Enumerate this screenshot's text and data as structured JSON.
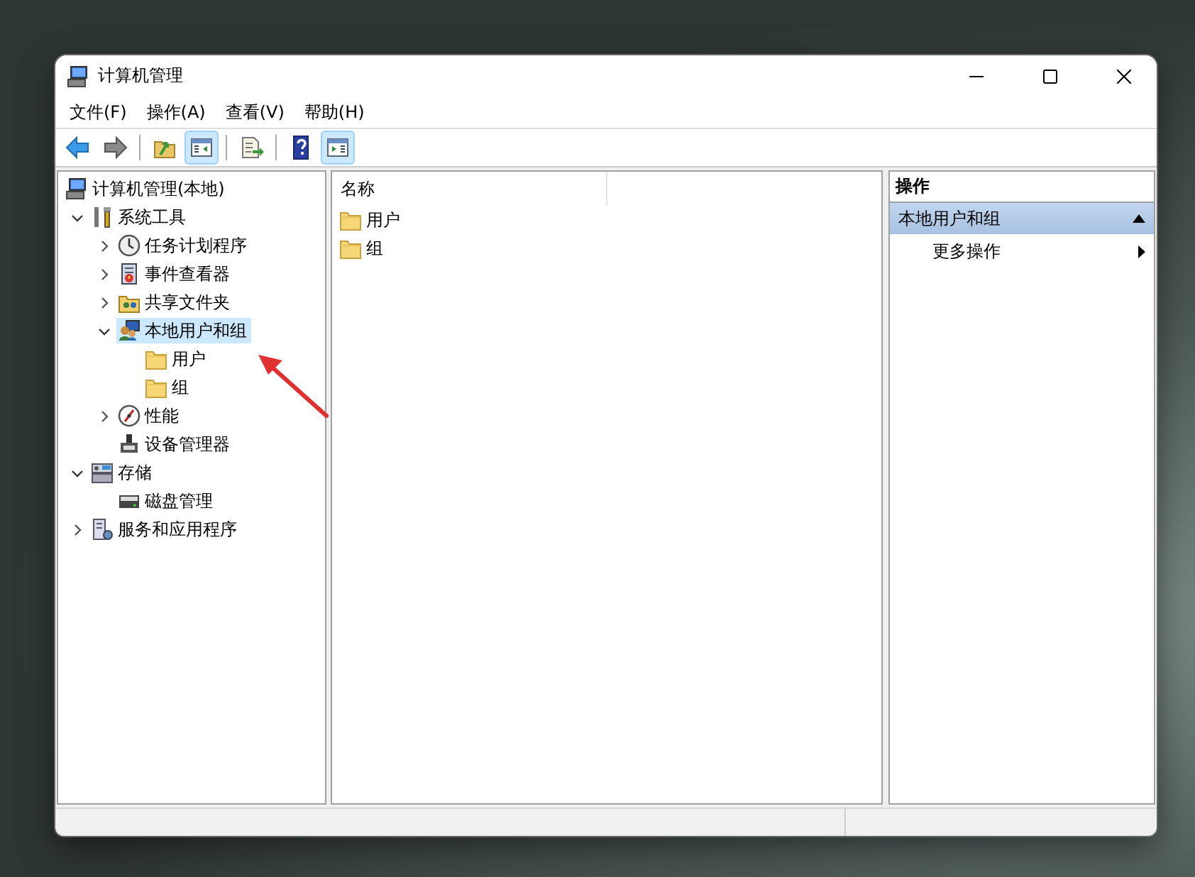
{
  "window": {
    "title": "计算机管理"
  },
  "menu": [
    {
      "label": "文件(F)"
    },
    {
      "label": "操作(A)"
    },
    {
      "label": "查看(V)"
    },
    {
      "label": "帮助(H)"
    }
  ],
  "toolbar": [
    {
      "kind": "back",
      "pressed": false
    },
    {
      "kind": "forward",
      "pressed": false
    },
    {
      "kind": "separator"
    },
    {
      "kind": "up",
      "pressed": false
    },
    {
      "kind": "tree-toggle",
      "pressed": true
    },
    {
      "kind": "separator"
    },
    {
      "kind": "export",
      "pressed": false
    },
    {
      "kind": "separator"
    },
    {
      "kind": "help",
      "pressed": false
    },
    {
      "kind": "action-toggle",
      "pressed": true
    }
  ],
  "tree": [
    {
      "label": "计算机管理(本地)",
      "kind": "computer",
      "selected": false,
      "children": [
        {
          "label": "系统工具",
          "kind": "tools",
          "expanded": true,
          "selected": false,
          "children": [
            {
              "label": "任务计划程序",
              "kind": "clock",
              "expanded": false,
              "selected": false
            },
            {
              "label": "事件查看器",
              "kind": "event",
              "expanded": false,
              "selected": false
            },
            {
              "label": "共享文件夹",
              "kind": "share",
              "expanded": false,
              "selected": false
            },
            {
              "label": "本地用户和组",
              "kind": "users",
              "expanded": true,
              "selected": true,
              "children": [
                {
                  "label": "用户",
                  "kind": "folder",
                  "selected": false
                },
                {
                  "label": "组",
                  "kind": "folder",
                  "selected": false
                }
              ]
            },
            {
              "label": "性能",
              "kind": "perf",
              "expanded": false,
              "selected": false
            },
            {
              "label": "设备管理器",
              "kind": "device",
              "selected": false
            }
          ]
        },
        {
          "label": "存储",
          "kind": "storage",
          "expanded": true,
          "selected": false,
          "children": [
            {
              "label": "磁盘管理",
              "kind": "disk",
              "selected": false
            }
          ]
        },
        {
          "label": "服务和应用程序",
          "kind": "services",
          "expanded": false,
          "selected": false
        }
      ]
    }
  ],
  "list": {
    "columns": [
      "名称"
    ],
    "items": [
      {
        "label": "用户"
      },
      {
        "label": "组"
      }
    ]
  },
  "actions": {
    "title": "操作",
    "section": {
      "label": "本地用户和组",
      "expanded": true
    },
    "items": [
      {
        "label": "更多操作"
      }
    ]
  }
}
